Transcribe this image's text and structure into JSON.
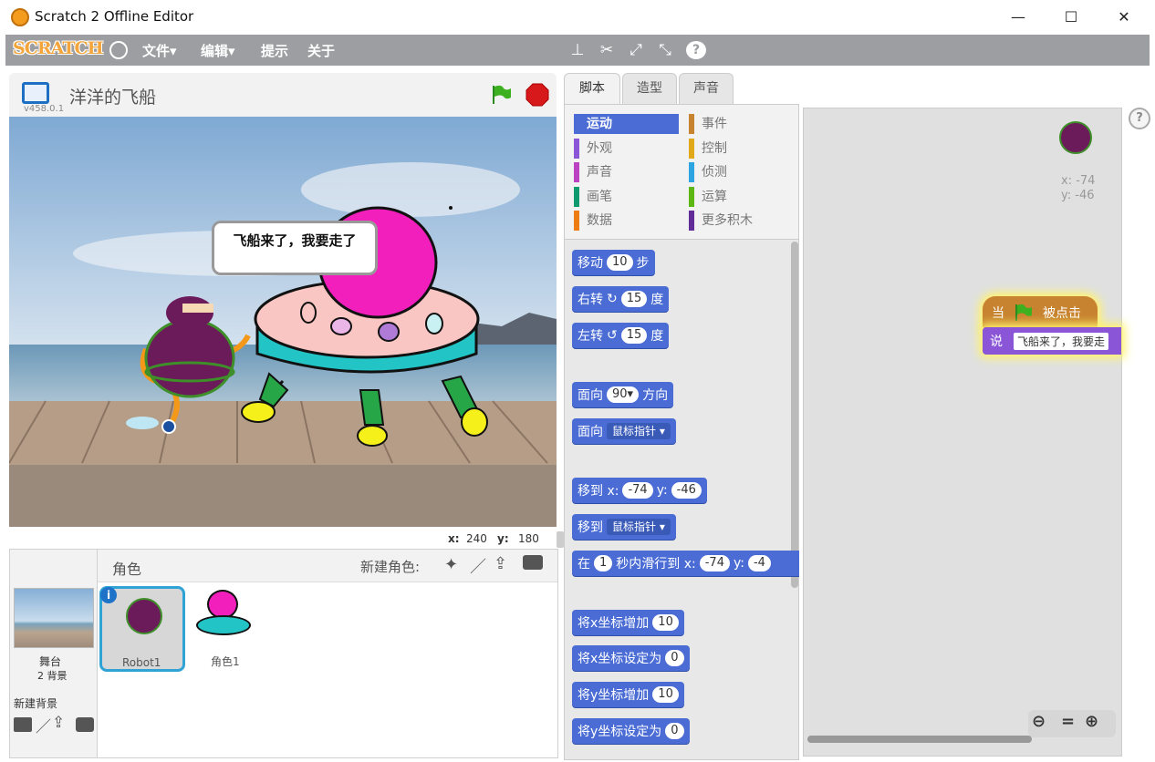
{
  "window": {
    "title": "Scratch 2 Offline Editor",
    "minimize": "—",
    "maximize": "☐",
    "close": "✕"
  },
  "menubar": {
    "logo": "SCRATCH",
    "file": "文件▾",
    "edit": "编辑▾",
    "tips": "提示",
    "about": "关于"
  },
  "stage": {
    "title": "洋洋的飞船",
    "version": "v458.0.1",
    "bubble": "飞船来了，我要走了",
    "x_label": "x:",
    "x_value": "240",
    "y_label": "y:",
    "y_value": "180"
  },
  "sprites": {
    "header": "角色",
    "new_sprite": "新建角色:",
    "stage_label": "舞台",
    "stage_bg": "2 背景",
    "new_backdrop": "新建背景",
    "list": [
      "Robot1",
      "角色1"
    ]
  },
  "tabs": {
    "scripts": "脚本",
    "costumes": "造型",
    "sounds": "声音"
  },
  "categories": {
    "left": [
      "运动",
      "外观",
      "声音",
      "画笔",
      "数据"
    ],
    "right": [
      "事件",
      "控制",
      "侦测",
      "运算",
      "更多积木"
    ]
  },
  "blocks": {
    "move": "移动",
    "move_val": "10",
    "move_unit": "步",
    "turn_r": "右转",
    "turn_r_val": "15",
    "turn_unit": "度",
    "turn_l": "左转",
    "turn_l_val": "15",
    "point_dir": "面向",
    "point_dir_val": "90▾",
    "point_dir_unit": "方向",
    "point_to": "面向",
    "mouse_ptr": "鼠标指针 ▾",
    "goto_xy": "移到 x:",
    "goto_x": "-74",
    "goto_y_label": "y:",
    "goto_y": "-46",
    "goto": "移到",
    "glide_a": "在",
    "glide_secs": "1",
    "glide_b": "秒内滑行到 x:",
    "glide_x": "-74",
    "glide_y_label": "y:",
    "glide_y": "-4",
    "change_x": "将x坐标增加",
    "change_x_val": "10",
    "set_x": "将x坐标设定为",
    "set_x_val": "0",
    "change_y": "将y坐标增加",
    "change_y_val": "10",
    "set_y": "将y坐标设定为",
    "set_y_val": "0"
  },
  "script_area": {
    "sprite_x": "x: -74",
    "sprite_y": "y: -46",
    "hat_a": "当",
    "hat_b": "被点击",
    "say": "说",
    "say_text": "飞船来了，我要走"
  },
  "colors": {
    "motion": "#4a6cd4",
    "looks": "#8a55d7",
    "sound": "#bb42c3",
    "pen": "#0e9a6c",
    "data": "#ee7d16",
    "events": "#c88330",
    "control": "#e1a91a",
    "sensing": "#2ca5e2",
    "operators": "#5cb712",
    "more": "#632d99"
  }
}
